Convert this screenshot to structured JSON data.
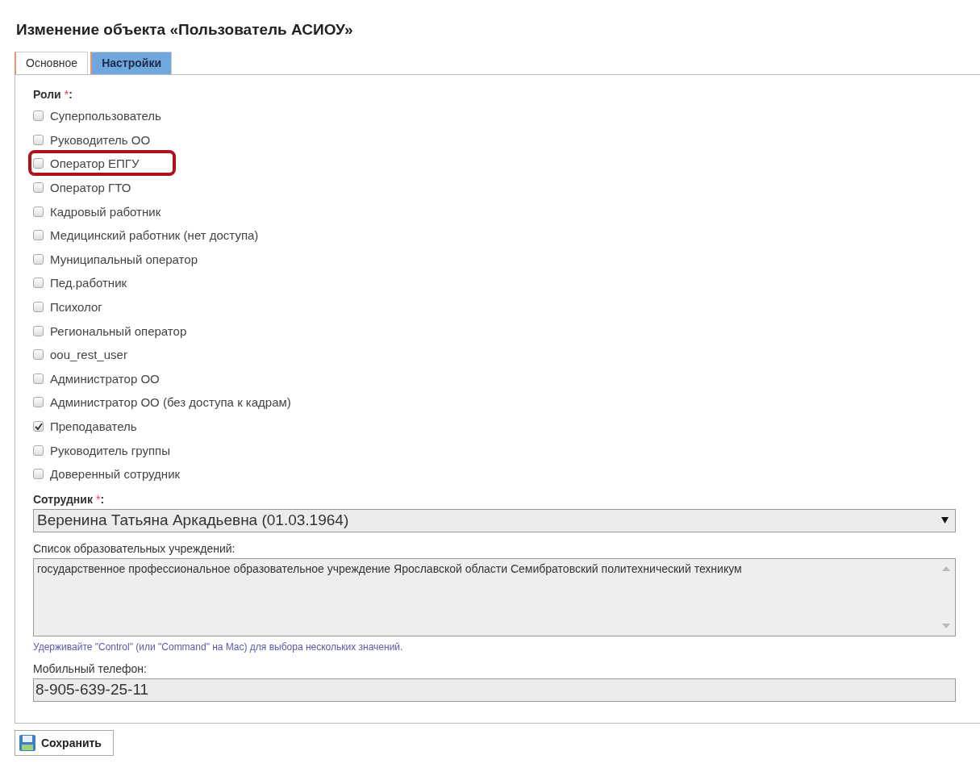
{
  "title": "Изменение объекта «Пользователь АСИОУ»",
  "tabs": [
    {
      "label": "Основное",
      "selected": false
    },
    {
      "label": "Настройки",
      "selected": true
    }
  ],
  "roles": {
    "label": "Роли",
    "required_mark": "*",
    "suffix": ":",
    "items": [
      {
        "label": "Суперпользователь",
        "checked": false,
        "highlighted": false
      },
      {
        "label": "Руководитель ОО",
        "checked": false,
        "highlighted": false
      },
      {
        "label": "Оператор ЕПГУ",
        "checked": false,
        "highlighted": true
      },
      {
        "label": "Оператор ГТО",
        "checked": false,
        "highlighted": false
      },
      {
        "label": "Кадровый работник",
        "checked": false,
        "highlighted": false
      },
      {
        "label": "Медицинский работник (нет доступа)",
        "checked": false,
        "highlighted": false
      },
      {
        "label": "Муниципальный оператор",
        "checked": false,
        "highlighted": false
      },
      {
        "label": "Пед.работник",
        "checked": false,
        "highlighted": false
      },
      {
        "label": "Психолог",
        "checked": false,
        "highlighted": false
      },
      {
        "label": "Региональный оператор",
        "checked": false,
        "highlighted": false
      },
      {
        "label": "oou_rest_user",
        "checked": false,
        "highlighted": false
      },
      {
        "label": "Администратор ОО",
        "checked": false,
        "highlighted": false
      },
      {
        "label": "Администратор ОО (без доступа к кадрам)",
        "checked": false,
        "highlighted": false
      },
      {
        "label": "Преподаватель",
        "checked": true,
        "highlighted": false
      },
      {
        "label": "Руководитель группы",
        "checked": false,
        "highlighted": false
      },
      {
        "label": "Доверенный сотрудник",
        "checked": false,
        "highlighted": false
      }
    ]
  },
  "employee": {
    "label": "Сотрудник",
    "required_mark": "*",
    "suffix": ":",
    "value": "Веренина Татьяна Аркадьевна (01.03.1964)"
  },
  "institutions": {
    "label": "Список образовательных учреждений:",
    "items": [
      "государственное профессиональное образовательное учреждение Ярославской области Семибратовский политехнический техникум"
    ],
    "hint": "Удерживайте \"Control\" (или \"Command\" на Mac) для выбора нескольких значений."
  },
  "phone": {
    "label": "Мобильный телефон:",
    "value": "8-905-639-25-11"
  },
  "save_button": "Сохранить"
}
